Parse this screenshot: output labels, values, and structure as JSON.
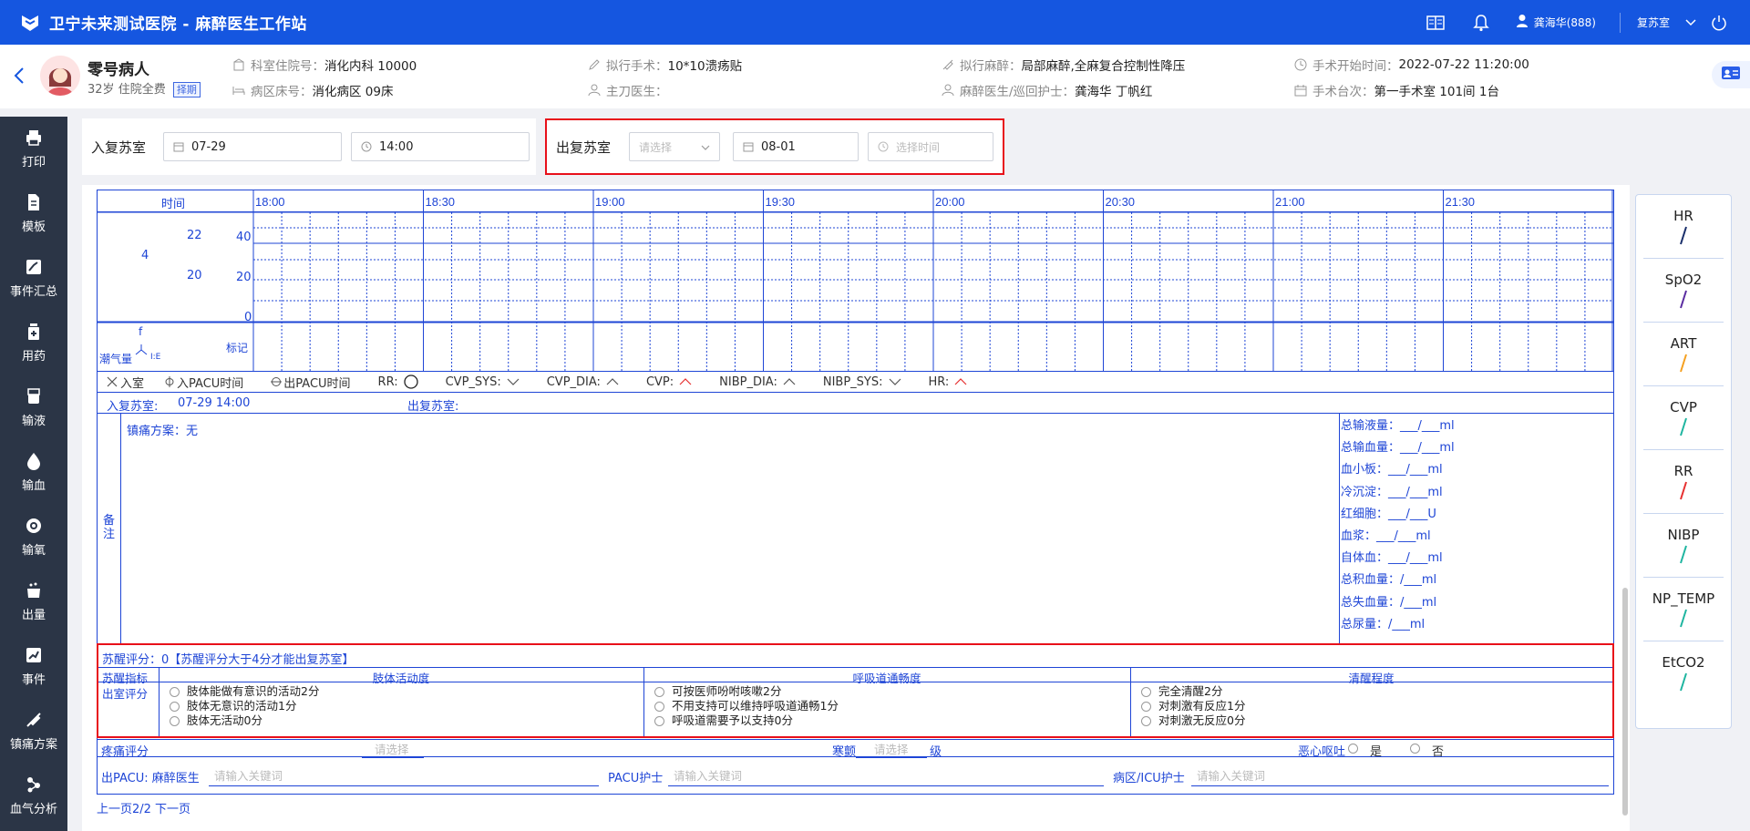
{
  "app": {
    "title": "卫宁未来测试医院 - 麻醉医生工作站",
    "user": "龚海华(888)",
    "room": "复苏室"
  },
  "patient": {
    "name": "零号病人",
    "age": "32岁",
    "pay_type": "住院全费",
    "badge": "择期",
    "fields": [
      {
        "label": "科室住院号：",
        "value": "消化内科 10000",
        "icon": "building-icon"
      },
      {
        "label": "病区床号：",
        "value": "消化病区 09床",
        "icon": "bed-icon"
      },
      {
        "label": "拟行手术：",
        "value": "10*10溃疡贴",
        "icon": "pen-icon"
      },
      {
        "label": "主刀医生：",
        "value": "",
        "icon": "user-icon"
      },
      {
        "label": "拟行麻醉：",
        "value": "局部麻醉,全麻复合控制性降压",
        "icon": "syringe-icon"
      },
      {
        "label": "麻醉医生/巡回护士：",
        "value": "龚海华 丁帆红",
        "icon": "user-icon"
      },
      {
        "label": "手术开始时间：",
        "value": "2022-07-22 11:20:00",
        "icon": "clock-icon"
      },
      {
        "label": "手术台次：",
        "value": "第一手术室 101间 1台",
        "icon": "calendar-icon"
      }
    ]
  },
  "sidebar": {
    "items": [
      {
        "label": "打印",
        "icon": "printer-icon"
      },
      {
        "label": "模板",
        "icon": "document-icon"
      },
      {
        "label": "事件汇总",
        "icon": "chart-edit-icon"
      },
      {
        "label": "用药",
        "icon": "medicine-icon"
      },
      {
        "label": "输液",
        "icon": "infusion-icon"
      },
      {
        "label": "输血",
        "icon": "blood-drop-icon"
      },
      {
        "label": "输氧",
        "icon": "oxygen-icon"
      },
      {
        "label": "出量",
        "icon": "output-icon"
      },
      {
        "label": "事件",
        "icon": "event-icon"
      },
      {
        "label": "镇痛方案",
        "icon": "analgesia-icon"
      },
      {
        "label": "血气分析",
        "icon": "molecule-icon"
      }
    ]
  },
  "entry": {
    "label": "入复苏室",
    "date": "07-29",
    "time": "14:00"
  },
  "exit": {
    "label": "出复苏室",
    "select_placeholder": "请选择",
    "date": "08-01",
    "time_placeholder": "选择时间"
  },
  "chart": {
    "time_header": "时间",
    "times": [
      "18:00",
      "18:30",
      "19:00",
      "19:30",
      "20:00",
      "20:30",
      "21:00",
      "21:30"
    ],
    "axis_labels": [
      "22",
      "20",
      "40",
      "20",
      "0",
      "4"
    ],
    "tidal_label": "潮气量",
    "f_label": "f",
    "ie_label": "I:E",
    "mark_label": "标记",
    "legend_items": [
      "入室",
      "入PACU时间",
      "出PACU时间",
      "RR:",
      "CVP_SYS:",
      "CVP_DIA:",
      "CVP:",
      "NIBP_DIA:",
      "NIBP_SYS:",
      "HR:"
    ],
    "entry_text": "入复苏室:",
    "entry_value": "07-29 14:00",
    "exit_text": "出复苏室:",
    "remarks_label": "备注",
    "analgesia": "镇痛方案：无",
    "totals": [
      {
        "label": "总输液量：",
        "value": "___/___ml"
      },
      {
        "label": "总输血量：",
        "value": "___/___ml"
      },
      {
        "label": "血小板：",
        "value": "___/___ml"
      },
      {
        "label": "冷沉淀：",
        "value": "___/___ml"
      },
      {
        "label": "红细胞：",
        "value": "___/___U"
      },
      {
        "label": "血浆：",
        "value": "___/___ml"
      },
      {
        "label": "自体血：",
        "value": "___/___ml"
      },
      {
        "label": "总积血量：",
        "value": "/___ml"
      },
      {
        "label": "总失血量：",
        "value": "/___ml"
      },
      {
        "label": "总尿量：",
        "value": "/___ml"
      }
    ]
  },
  "score": {
    "title": "苏醒评分：0【苏醒评分大于4分才能出复苏室】",
    "indicator_label": "苏醒指标",
    "exit_label": "出室评分",
    "columns": [
      "肢体活动度",
      "呼吸道通畅度",
      "清醒程度"
    ],
    "options": [
      [
        "肢体能做有意识的活动2分",
        "肢体无意识的活动1分",
        "肢体无活动0分"
      ],
      [
        "可按医师吩咐咳嗽2分",
        "不用支持可以维持呼吸道通畅1分",
        "呼吸道需要予以支持0分"
      ],
      [
        "完全清醒2分",
        "对刺激有反应1分",
        "对刺激无反应0分"
      ]
    ]
  },
  "pain": {
    "label": "疼痛评分",
    "placeholder": "请选择",
    "level_label": "寒颤",
    "level_placeholder": "请选择",
    "level_unit": "级",
    "nausea_label": "恶心呕吐",
    "yes": "是",
    "no": "否"
  },
  "sign": {
    "pacu_label": "出PACU: 麻醉医生",
    "pacu_nurse_label": "PACU护士",
    "ward_nurse_label": "病区/ICU护士",
    "placeholder": "请输入关键词"
  },
  "pager": "上一页2/2 下一页",
  "legend_panel": [
    {
      "name": "HR",
      "color": "#1a2f6b"
    },
    {
      "name": "SpO2",
      "color": "#5a2ca0"
    },
    {
      "name": "ART",
      "color": "#f5a020"
    },
    {
      "name": "CVP",
      "color": "#1fb5a0"
    },
    {
      "name": "RR",
      "color": "#e63030"
    },
    {
      "name": "NIBP",
      "color": "#1fb5a0"
    },
    {
      "name": "NP_TEMP",
      "color": "#1fb5a0"
    },
    {
      "name": "EtCO2",
      "color": "#1fb5a0"
    }
  ]
}
